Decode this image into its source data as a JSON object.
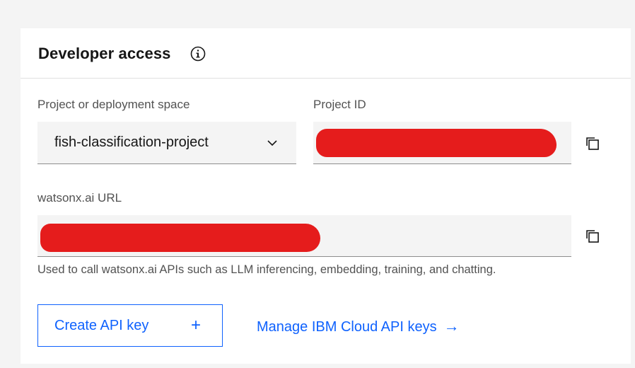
{
  "card": {
    "title": "Developer access",
    "info_icon": "info-icon"
  },
  "project_space": {
    "label": "Project or deployment space",
    "value": "fish-classification-project",
    "chevron_icon": "chevron-down-icon"
  },
  "project_id": {
    "label": "Project ID",
    "value_redacted": true,
    "copy_icon": "copy-icon"
  },
  "url": {
    "label": "watsonx.ai URL",
    "value_redacted": true,
    "copy_icon": "copy-icon",
    "helper_text": "Used to call watsonx.ai APIs such as LLM inferencing, embedding, training, and chatting."
  },
  "actions": {
    "create_api_key_label": "Create API key",
    "create_api_key_icon": "+",
    "manage_keys_label": "Manage IBM Cloud API keys",
    "manage_keys_icon": "→"
  },
  "colors": {
    "accent": "#0f62fe",
    "redaction": "#e51c1c",
    "field_bg": "#f4f4f4"
  }
}
